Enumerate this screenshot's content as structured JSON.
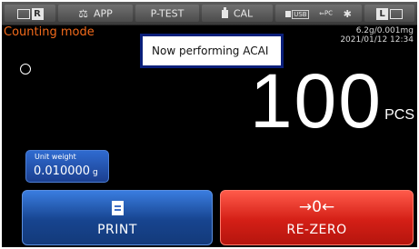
{
  "status_bar": {
    "app_label": "APP",
    "ptest_label": "P-TEST",
    "cal_label": "CAL",
    "usb_label": "USB",
    "pc_label": "PC",
    "r_label": "R",
    "l_label": "L"
  },
  "mode": {
    "title": "Counting mode",
    "readability": "6.2g/0.001mg",
    "datetime": "2021/01/12  12:34"
  },
  "overlay": {
    "message": "Now performing ACAI"
  },
  "reading": {
    "value": "100",
    "unit": "PCS"
  },
  "unit_weight": {
    "label": "Unit weight",
    "value": "0.010000",
    "unit": "g"
  },
  "buttons": {
    "print": {
      "label": "PRINT"
    },
    "rezero": {
      "label": "RE-ZERO",
      "icon_text": "→0←"
    }
  },
  "colors": {
    "mode_title": "#f26a1b",
    "overlay_border": "#0a1f7a",
    "print_button": "#1e56b8",
    "rezero_button": "#e02a1f"
  }
}
